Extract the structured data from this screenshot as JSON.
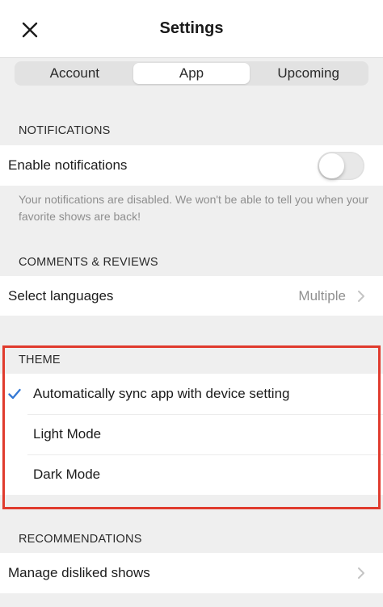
{
  "nav": {
    "title": "Settings",
    "close_icon": "close-icon"
  },
  "tabs": [
    {
      "label": "Account",
      "active": false
    },
    {
      "label": "App",
      "active": true
    },
    {
      "label": "Upcoming",
      "active": false
    }
  ],
  "notifications": {
    "header": "NOTIFICATIONS",
    "enable_label": "Enable notifications",
    "enabled": false,
    "footnote": "Your notifications are disabled. We won't be able to tell you when your favorite shows are back!"
  },
  "comments": {
    "header": "COMMENTS & REVIEWS",
    "languages_label": "Select languages",
    "languages_value": "Multiple"
  },
  "theme": {
    "header": "THEME",
    "options": [
      {
        "label": "Automatically sync app with device setting",
        "selected": true
      },
      {
        "label": "Light Mode",
        "selected": false
      },
      {
        "label": "Dark Mode",
        "selected": false
      }
    ],
    "highlight_color": "#e03b2d"
  },
  "recommendations": {
    "header": "RECOMMENDATIONS",
    "disliked_label": "Manage disliked shows"
  },
  "colors": {
    "accent": "#3478d4",
    "chevron": "#c4c4c4"
  }
}
